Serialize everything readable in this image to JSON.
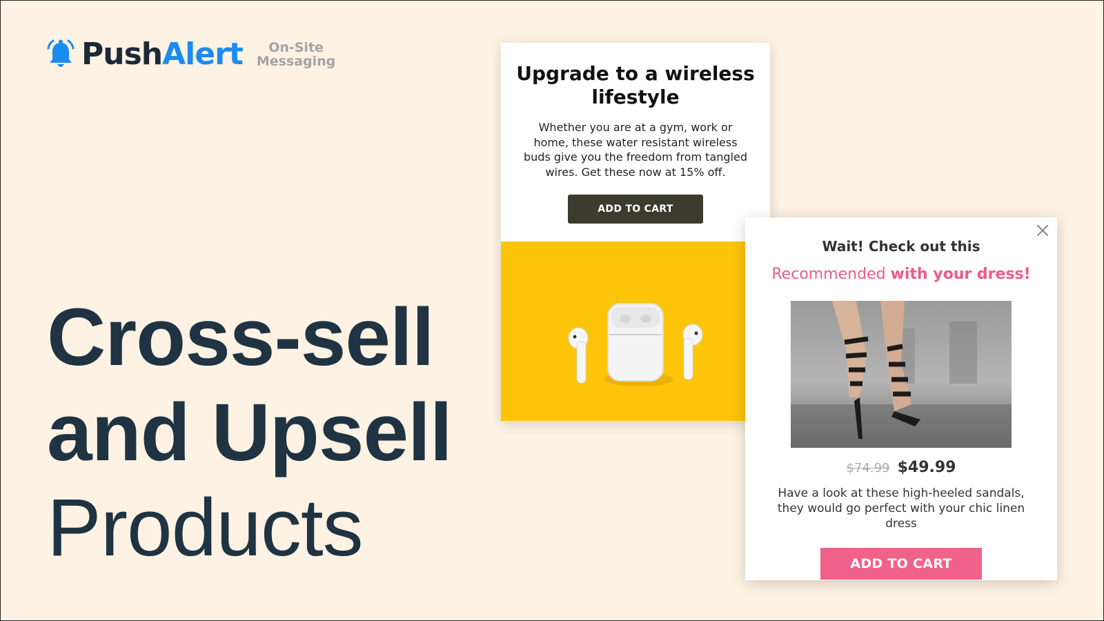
{
  "brand": {
    "name_part1": "Push",
    "name_part2": "Alert",
    "tagline_line1": "On-Site",
    "tagline_line2": "Messaging",
    "icon": "bell-icon",
    "colors": {
      "dark": "#1d2a36",
      "accent": "#1a8cf0"
    }
  },
  "headline": {
    "line1": "Cross-sell",
    "line2": "and Upsell",
    "line3": "Products",
    "color": "#1f3342"
  },
  "card_wireless": {
    "title": "Upgrade to a wireless lifestyle",
    "body": "Whether you are at a gym, work or home, these water resistant wireless buds give you the freedom from tangled wires. Get these now at 15% off.",
    "button": "ADD TO CART",
    "image": "wireless-earbuds-image",
    "image_bg": "#fdc50a",
    "button_color": "#3b3b2e"
  },
  "card_recommend": {
    "title": "Wait! Check out this",
    "subtitle_plain": "Recommended ",
    "subtitle_bold": "with your dress!",
    "image": "high-heeled-sandals-image",
    "old_price": "$74.99",
    "new_price": "$49.99",
    "body": "Have a look at these high-heeled sandals, they would go perfect with your chic linen dress",
    "button": "ADD TO CART",
    "accent": "#f06289",
    "close_icon": "close-icon"
  }
}
